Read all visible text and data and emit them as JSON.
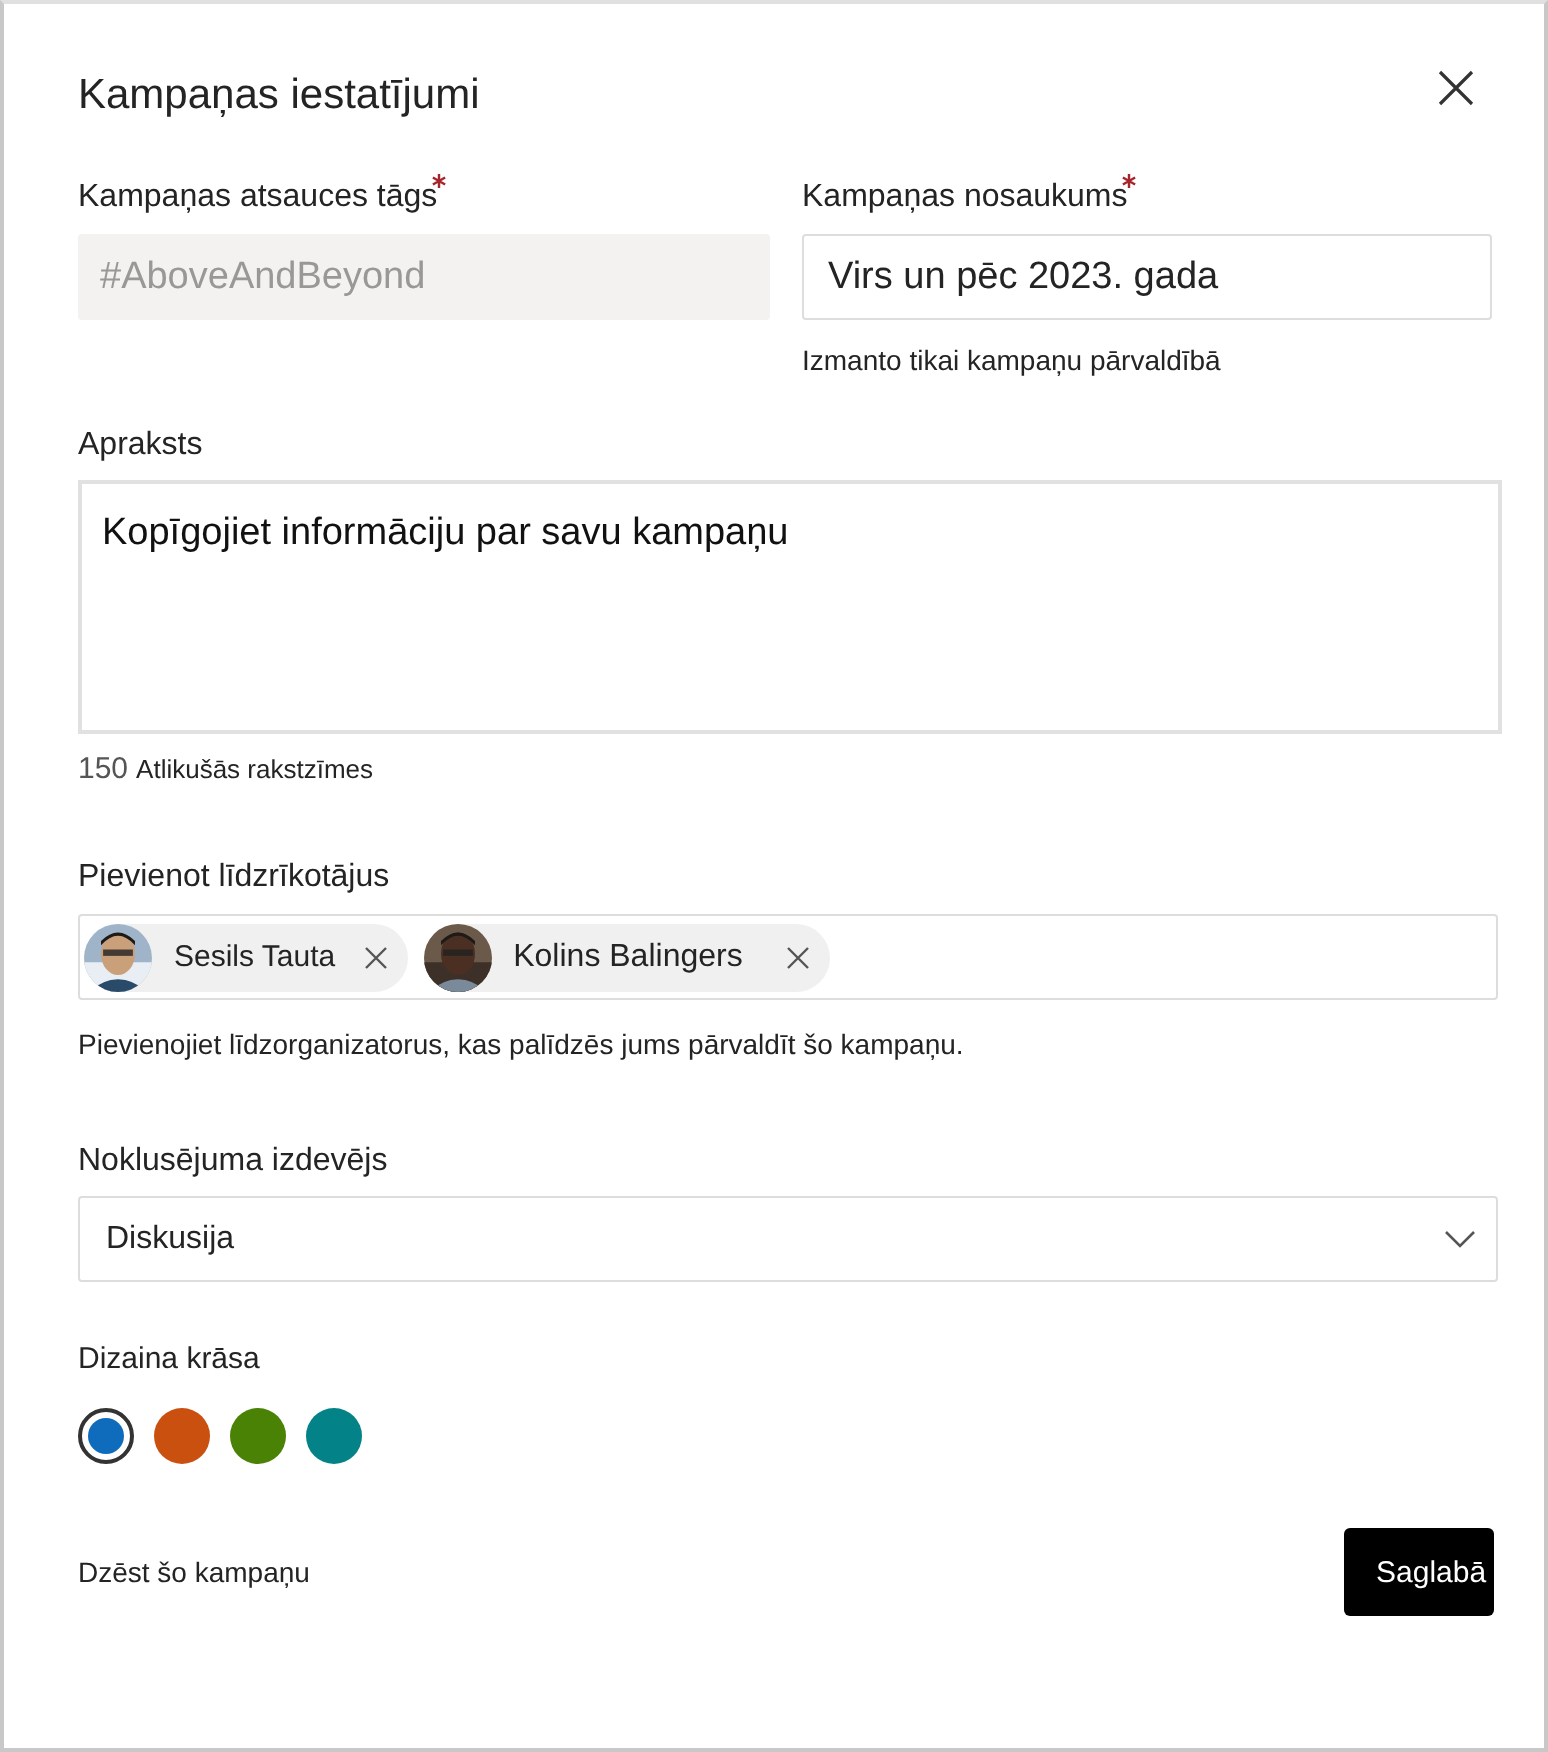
{
  "dialog": {
    "title": "Kampaņas iestatījumi"
  },
  "tag_field": {
    "label": "Kampaņas atsauces tāgs",
    "required": true,
    "placeholder": "#AboveAndBeyond",
    "disabled": true
  },
  "name_field": {
    "label": "Kampaņas nosaukums",
    "required": true,
    "value": "Virs un pēc 2023. gada",
    "hint": "Izmanto tikai kampaņu pārvaldībā"
  },
  "description": {
    "label": "Apraksts",
    "placeholder": "Kopīgojiet informāciju par savu kampaņu",
    "counter": "150",
    "counter_label": "Atlikušās rakstzīmes"
  },
  "coorganizers": {
    "label": "Pievienot līdzrīkotājus",
    "people": [
      {
        "name": "Sesils Tauta"
      },
      {
        "name": "Kolins Balingers"
      }
    ],
    "hint": "Pievienojiet līdzorganizatorus, kas palīdzēs jums pārvaldīt šo kampaņu."
  },
  "publisher": {
    "label": "Noklusējuma izdevējs",
    "value": "Diskusija"
  },
  "theme": {
    "label": "Dizaina krāsa",
    "colors": [
      {
        "color": "#0f6cbd",
        "selected": true
      },
      {
        "color": "#ca5010",
        "selected": false
      },
      {
        "color": "#498205",
        "selected": false
      },
      {
        "color": "#038387",
        "selected": false
      }
    ]
  },
  "delete_link": "Dzēst šo kampaņu",
  "save_button": "Saglabā"
}
